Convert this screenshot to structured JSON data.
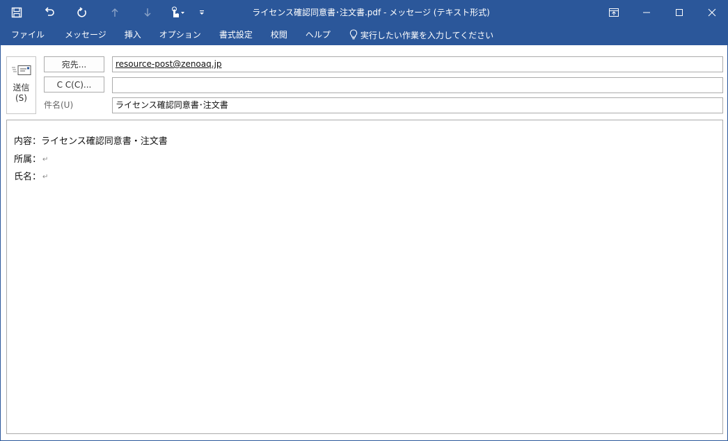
{
  "window": {
    "title": "ライセンス確認同意書･注文書.pdf  -  メッセージ (テキスト形式)"
  },
  "quick_access": {
    "icons": [
      "save-icon",
      "undo-icon",
      "redo-icon",
      "previous-item-icon",
      "next-item-icon",
      "touch-mode-icon",
      "customize-toolbar-icon"
    ]
  },
  "window_controls": {
    "icons": [
      "ribbon-display-options-icon",
      "minimize-icon",
      "maximize-icon",
      "close-icon"
    ]
  },
  "ribbon": {
    "tabs": [
      {
        "label": "ファイル"
      },
      {
        "label": "メッセージ"
      },
      {
        "label": "挿入"
      },
      {
        "label": "オプション"
      },
      {
        "label": "書式設定"
      },
      {
        "label": "校閲"
      },
      {
        "label": "ヘルプ"
      }
    ],
    "tell_me": "実行したい作業を入力してください"
  },
  "compose": {
    "send_label_line1": "送信",
    "send_label_line2": "(S)",
    "to_button": "宛先...",
    "to_value": "resource-post@zenoaq.jp",
    "cc_button": "C C(C)...",
    "cc_value": "",
    "subject_label": "件名(U)",
    "subject_value": "ライセンス確認同意書･注文書",
    "body_lines": [
      {
        "text": "内容：ライセンス確認同意書・注文書",
        "mark": ""
      },
      {
        "text": "所属：",
        "mark": "↵"
      },
      {
        "text": "氏名：",
        "mark": "↵"
      }
    ]
  },
  "colors": {
    "accent": "#2b579a",
    "border": "#ababab"
  }
}
